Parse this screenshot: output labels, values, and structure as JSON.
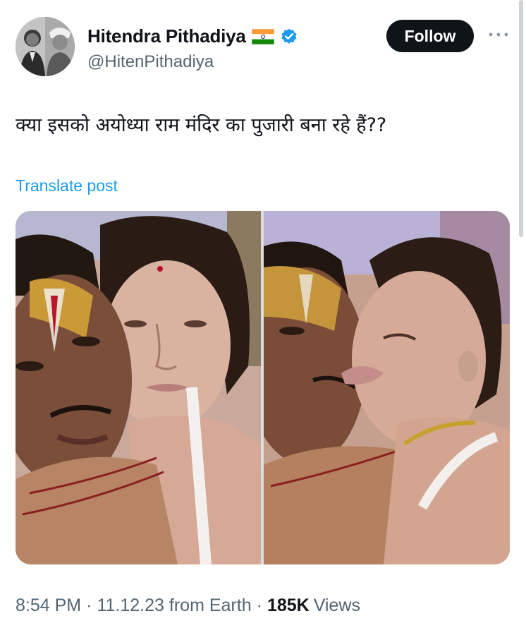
{
  "author": {
    "display_name": "Hitendra Pithadiya",
    "handle": "@HitenPithadiya",
    "verified": true,
    "flag_icon": "india-flag-icon"
  },
  "actions": {
    "follow_label": "Follow",
    "more_icon": "more-horizontal-icon"
  },
  "post": {
    "text": "क्या इसको अयोध्या राम मंदिर का पुजारी बना रहे हैं??",
    "translate_label": "Translate post"
  },
  "media": {
    "photos": [
      "left-photo",
      "right-photo"
    ]
  },
  "meta": {
    "time": "8:54 PM",
    "separator_1": "·",
    "date": "11.12.23",
    "source": "from Earth",
    "separator_2": "·",
    "views_count": "185K",
    "views_label": "Views"
  },
  "colors": {
    "text_primary": "#0f1419",
    "text_secondary": "#536471",
    "link": "#1d9bf0",
    "follow_bg": "#0f1419",
    "verified": "#1d9bf0"
  }
}
